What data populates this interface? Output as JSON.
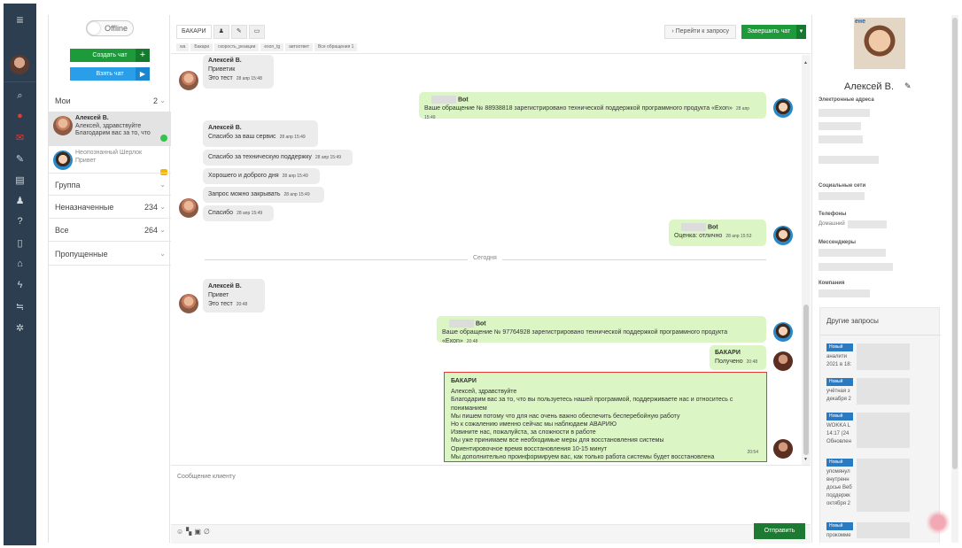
{
  "rail": {
    "icon_colors": [
      "#cfd6dd",
      "#e53935",
      "#e53935",
      "#cfd6dd"
    ]
  },
  "list": {
    "status_toggle": "Offline",
    "create_chat": "Создать чат",
    "take_chat": "Взять чат",
    "groups": [
      {
        "name": "Мои",
        "count": "2"
      },
      {
        "name": "Группа",
        "count": ""
      },
      {
        "name": "Неназначенные",
        "count": "234"
      },
      {
        "name": "Все",
        "count": "264"
      },
      {
        "name": "Пропущенные",
        "count": ""
      }
    ],
    "chats": [
      {
        "name": "Алексей В.",
        "line1": "Алексей, здравствуйте",
        "line2": "Благодарим вас за то, что"
      },
      {
        "name": "Неопознанный Шерлок",
        "line1": "Привет",
        "line2": ""
      }
    ]
  },
  "chat": {
    "tabs": [
      "БАКАРИ"
    ],
    "tags": [
      "wa",
      "Бакари",
      "скорость_реакции",
      "exon_tg",
      "автоответ",
      "Все обращения 1"
    ],
    "goto_request": "Перейти к запросу",
    "finish_chat": "Завершить чат",
    "divider": "Сегодня",
    "compose_placeholder": "Сообщение клиенту",
    "send": "Отправить",
    "messages": {
      "m1": {
        "name": "Алексей В.",
        "lines": [
          "Приветик",
          "Это тест"
        ],
        "time": "28 апр 15:48"
      },
      "m2": {
        "name": "Bot",
        "text": "Ваше обращение № 88938818 зарегистрировано технической поддержкой программного продукта «Exon»",
        "time": "28 апр 15:49"
      },
      "m3": {
        "name": "Алексей В.",
        "text": "Спасибо за ваш сервис",
        "time": "28 апр 15:49"
      },
      "m4": {
        "text": "Спасибо за техническую поддержку",
        "time": "28 апр 15:49"
      },
      "m5": {
        "text": "Хорошего и доброго дня",
        "time": "28 апр 15:49"
      },
      "m6": {
        "text": "Запрос можно закрывать",
        "time": "28 апр 15:49"
      },
      "m7": {
        "text": "Спасибо",
        "time": "28 апр 15:49"
      },
      "m8": {
        "name": "Bot",
        "text": "Оценка: отлично",
        "time": "28 апр 15:53"
      },
      "m9": {
        "name": "Алексей В.",
        "lines": [
          "Привет",
          "Это тест"
        ],
        "time": "20:48"
      },
      "m10": {
        "name": "Bot",
        "text": "Ваше обращение № 97764928 зарегистрировано технической поддержкой программного продукта «Exon»",
        "time": "20:48"
      },
      "m11": {
        "name": "БАКАРИ",
        "text": "Получено",
        "time": "20:48"
      },
      "m12": {
        "name": "БАКАРИ",
        "lines": [
          "Алексей, здравствуйте",
          "Благодарим вас за то, что вы пользуетесь нашей программой, поддерживаете нас и относитесь с пониманием",
          "Мы пишем потому что для нас очень важно обеспечить бесперебойную работу",
          "Но к сожалению именно сейчас мы наблюдаем АВАРИЮ",
          "Извините нас, пожалуйста, за сложности в работе",
          "Мы уже принимаем все необходимые меры для восстановления системы",
          "Ориентировочное время восстановления 10-15 минут",
          "Мы дополнительно проинформируем вас, как только работа системы будет восстановлена"
        ],
        "time": "20:54"
      }
    }
  },
  "profile": {
    "photo_text": "ене",
    "name": "Алексей В.",
    "emails_label": "Электронные адреса",
    "social_label": "Социальные сети",
    "phones_label": "Телефоны",
    "home_label": "Домашний",
    "messengers_label": "Мессенджеры",
    "company_label": "Компания",
    "other_requests": "Другие запросы",
    "requests": [
      {
        "badge": "Новый",
        "lines": [
          "аналити",
          "2021 в 18:"
        ]
      },
      {
        "badge": "Новый",
        "lines": [
          "учётная з",
          "декабря 2"
        ]
      },
      {
        "badge": "Новый",
        "lines": [
          "WOKKA L",
          "14:17 (24",
          "Обновлен"
        ]
      },
      {
        "badge": "Новый",
        "lines": [
          "упомянул",
          "внутренн",
          "досье Веб",
          "поддержк",
          "октября 2"
        ]
      },
      {
        "badge": "Новый",
        "lines": [
          "прокомме"
        ]
      }
    ]
  }
}
